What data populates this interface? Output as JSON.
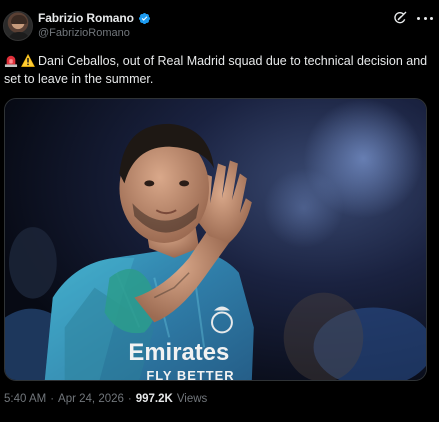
{
  "author": {
    "display_name": "Fabrizio Romano",
    "handle": "@FabrizioRomano",
    "verified": true,
    "accent_color": "#1d9bf0"
  },
  "icons": {
    "verified": "verified-badge-icon",
    "grok": "grok-icon",
    "more": "more-options-icon",
    "emoji_1": "siren-icon",
    "emoji_2": "warning-icon"
  },
  "tweet": {
    "text": "Dani Ceballos, out of Real Madrid squad due to technical decision and set to leave in the summer.",
    "media_text_sponsor": "Emirates",
    "media_text_sponsor_sub": "FLY BETTER"
  },
  "meta": {
    "time": "5:40 AM",
    "separator": "·",
    "date": "Apr 24, 2026",
    "views_count": "997.2K",
    "views_label": "Views"
  }
}
